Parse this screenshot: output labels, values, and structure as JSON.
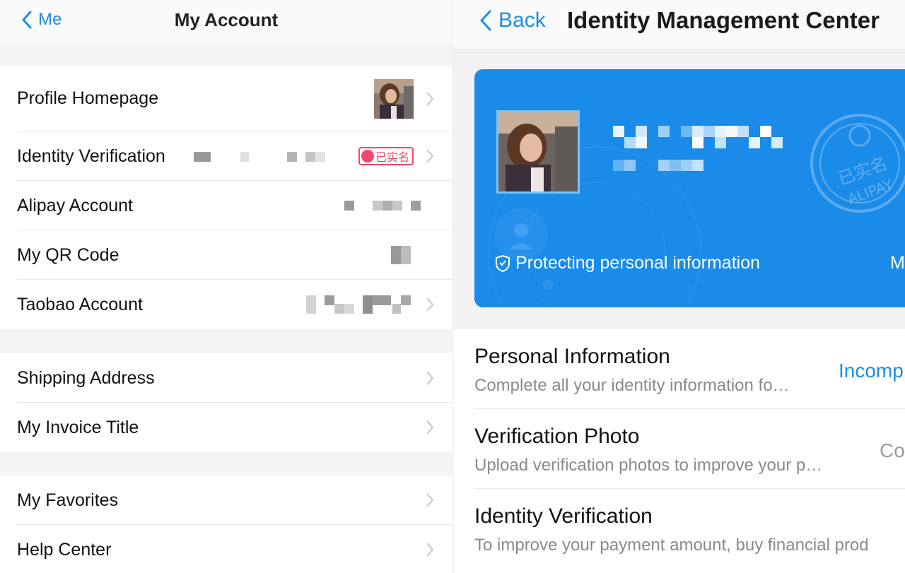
{
  "left": {
    "back_label": "Me",
    "title": "My Account",
    "groups": [
      [
        {
          "label": "Profile Homepage"
        },
        {
          "label": "Identity Verification",
          "badge": "已实名"
        },
        {
          "label": "Alipay Account"
        },
        {
          "label": "My QR Code"
        },
        {
          "label": "Taobao Account"
        }
      ],
      [
        {
          "label": "Shipping Address"
        },
        {
          "label": "My Invoice Title"
        }
      ],
      [
        {
          "label": "My Favorites"
        },
        {
          "label": "Help Center"
        }
      ]
    ]
  },
  "right": {
    "back_label": "Back",
    "title": "Identity Management Center",
    "card": {
      "footer": "Protecting personal information",
      "footer_right": "M",
      "stamp_text_top": "已实名",
      "stamp_text_bottom": "ALIPAY"
    },
    "rows": [
      {
        "title": "Personal Information",
        "subtitle": "Complete all your identity information fo…",
        "status": "Incomp"
      },
      {
        "title": "Verification Photo",
        "subtitle": "Upload verification photos to improve your p…",
        "status": "Co"
      },
      {
        "title": "Identity Verification",
        "subtitle": "To improve your payment amount, buy financial prod",
        "status": ""
      }
    ]
  },
  "colors": {
    "accent_blue": "#1a8ee6",
    "card_blue": "#1b8bea",
    "badge_pink": "#f0486a",
    "status_blue": "#1a8ee6",
    "status_gray": "#9a9a9a"
  },
  "icons": [
    "chevron-left-icon",
    "chevron-right-icon",
    "shield-icon",
    "verified-stamp-icon",
    "user-badge-icon"
  ]
}
